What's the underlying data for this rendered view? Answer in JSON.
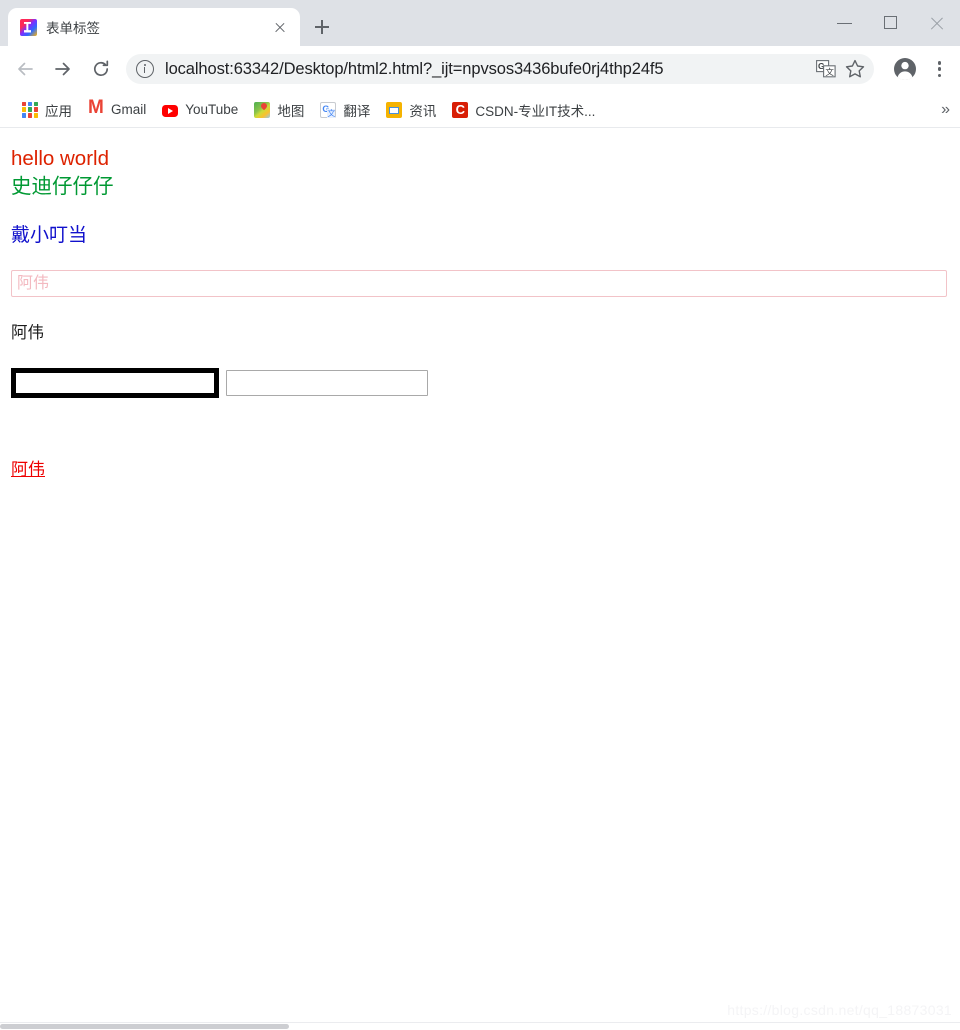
{
  "window": {
    "minimize_label": "Minimize",
    "maximize_label": "Maximize",
    "close_label": "Close"
  },
  "tab": {
    "title": "表单标签",
    "favicon": "intellij-idea-icon",
    "close_label": "×",
    "new_tab_label": "+"
  },
  "toolbar": {
    "back_label": "back-arrow-icon",
    "forward_label": "forward-arrow-icon",
    "reload_label": "reload-icon",
    "site_info_label": "site-info-icon",
    "translate_label": "translate-icon",
    "bookmark_star_label": "star-icon",
    "profile_label": "profile-avatar-icon",
    "menu_label": "three-dot-menu-icon"
  },
  "address": {
    "host": "localhost:63342",
    "path": "/Desktop/html2.html?_ijt=npvsos3436bufe0rj4thp24f5",
    "full_url": "localhost:63342/Desktop/html2.html?_ijt=npvsos3436bufe0rj4thp24f5"
  },
  "bookmarks": {
    "overflow_label": "»",
    "items": [
      {
        "label": "应用",
        "icon": "apps-grid-icon"
      },
      {
        "label": "Gmail",
        "icon": "gmail-icon"
      },
      {
        "label": "YouTube",
        "icon": "youtube-icon"
      },
      {
        "label": "地图",
        "icon": "maps-icon"
      },
      {
        "label": "翻译",
        "icon": "translate-icon"
      },
      {
        "label": "资讯",
        "icon": "news-icon"
      },
      {
        "label": "CSDN-专业IT技术...",
        "icon": "csdn-icon"
      }
    ]
  },
  "page": {
    "heading_line1": "hello world",
    "heading_line2": "史迪仔仔仔",
    "blue_text": "戴小叮当",
    "wide_input_placeholder": "阿伟",
    "wide_input_value": "",
    "plain_text": "阿伟",
    "thick_input_value": "",
    "thick_input_placeholder": "",
    "thin_input_value": "",
    "thin_input_placeholder": "",
    "red_link": "阿伟",
    "watermark": "https://blog.csdn.net/qq_18873031"
  },
  "colors": {
    "heading_red": "#dd2200",
    "heading_green": "#009933",
    "blue_text": "#1111cc",
    "link_red": "#ee0000",
    "placeholder_pink": "#f3b9c0",
    "input_pink_border": "#f2c3c8",
    "thick_border_black": "#000000",
    "thin_border_gray": "#a9a9a9"
  }
}
